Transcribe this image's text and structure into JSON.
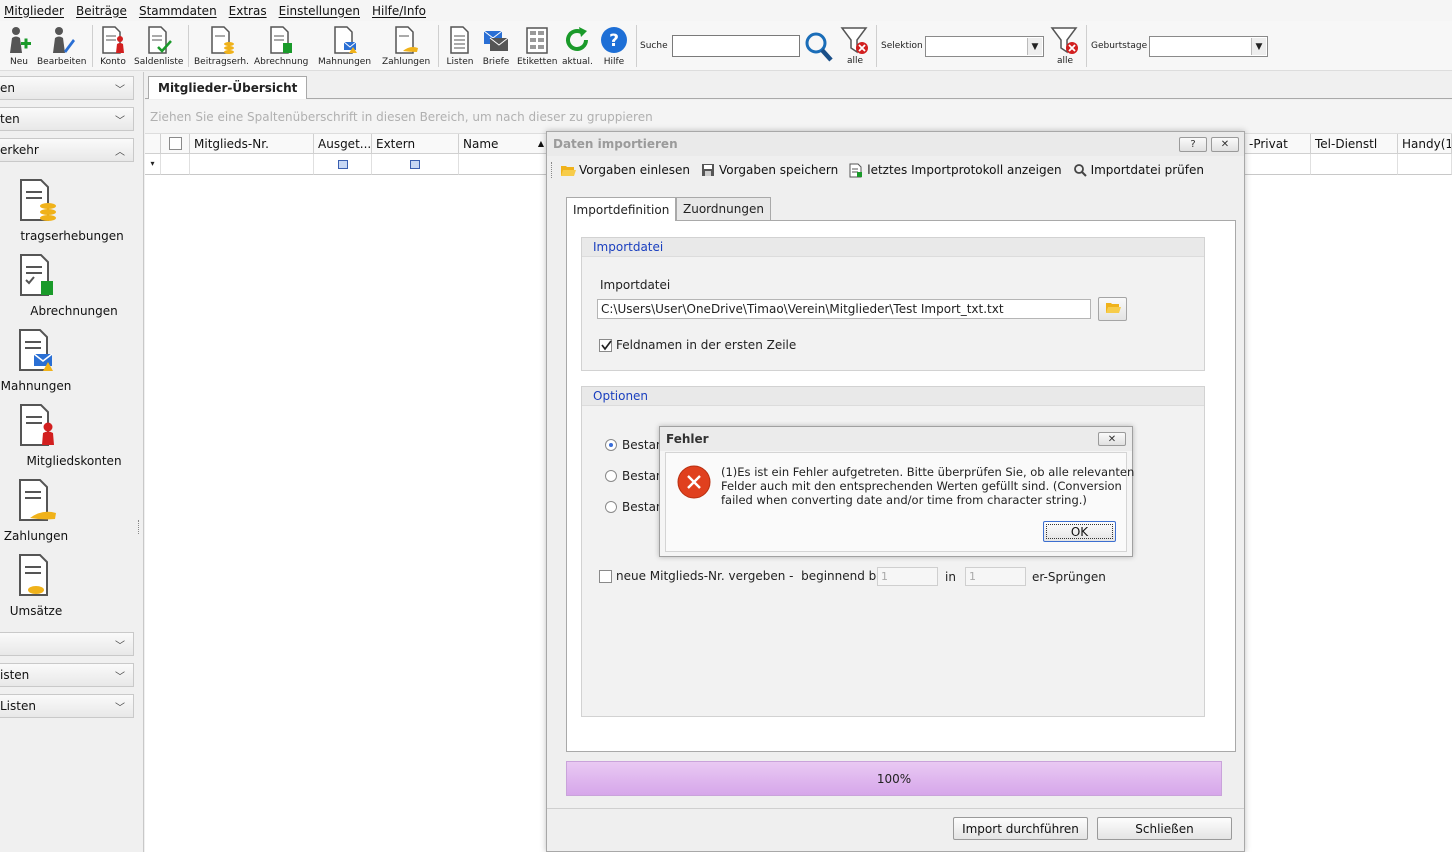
{
  "menu": [
    "Mitglieder",
    "Beiträge",
    "Stammdaten",
    "Extras",
    "Einstellungen",
    "Hilfe/Info"
  ],
  "toolbar": {
    "buttons": [
      {
        "label": "Neu"
      },
      {
        "label": "Bearbeiten"
      },
      {
        "label": "Konto"
      },
      {
        "label": "Saldenliste"
      },
      {
        "label": "Beitragserh."
      },
      {
        "label": "Abrechnung"
      },
      {
        "label": "Mahnungen"
      },
      {
        "label": "Zahlungen"
      },
      {
        "label": "Listen"
      },
      {
        "label": "Briefe"
      },
      {
        "label": "Etiketten"
      },
      {
        "label": "aktual."
      },
      {
        "label": "Hilfe"
      }
    ],
    "search_label": "Suche",
    "search_value": "",
    "filter_all_1": "alle",
    "selektion_label": "Selektion",
    "selektion_value": "",
    "filter_all_2": "alle",
    "geburtstage_label": "Geburtstage",
    "geburtstage_value": ""
  },
  "sidebar": {
    "headers": [
      "en",
      "ten",
      "erkehr"
    ],
    "items": [
      "tragserhebungen",
      "Abrechnungen",
      "Mahnungen",
      "Mitgliedskonten",
      "Zahlungen",
      "Umsätze"
    ],
    "headers_bottom": [
      "",
      "isten",
      "Listen"
    ]
  },
  "main": {
    "tab_title": "Mitglieder-Übersicht",
    "group_hint": "Ziehen Sie eine Spaltenüberschrift in diesen Bereich, um nach dieser zu gruppieren",
    "columns": [
      "Mitglieds-Nr.",
      "Ausget...",
      "Extern",
      "Name"
    ],
    "columns_right": [
      "-Privat",
      "Tel-Dienstl",
      "Handy(1)"
    ],
    "filter_icon": "▾"
  },
  "import_dialog": {
    "title": "Daten importieren",
    "help_btn": "?",
    "close_btn": "✕",
    "toolbar": [
      "Vorgaben einlesen",
      "Vorgaben speichern",
      "letztes Importprotokoll anzeigen",
      "Importdatei prüfen"
    ],
    "tabs": [
      "Importdefinition",
      "Zuordnungen"
    ],
    "group_file": {
      "header": "Importdatei",
      "label": "Importdatei",
      "path": "C:\\Users\\User\\OneDrive\\Timao\\Verein\\Mitglieder\\Test Import_txt.txt",
      "checkbox_label": "Feldnamen in der ersten Zeile",
      "checkbox_checked": true
    },
    "group_options": {
      "header": "Optionen",
      "radios": [
        "Bestan",
        "Bestan",
        "Bestan"
      ],
      "new_nr_label": "neue Mitglieds-Nr. vergeben -  beginnend bei",
      "start_value": "1",
      "in_label": "in",
      "step_value": "1",
      "steps_label": "er-Sprüngen"
    },
    "progress": "100%",
    "btn_import": "Import durchführen",
    "btn_close": "Schließen"
  },
  "error_dialog": {
    "title": "Fehler",
    "close": "✕",
    "message_l1": "(1)Es ist ein Fehler aufgetreten. Bitte überprüfen Sie, ob alle relevanten",
    "message_l2": "Felder auch mit den entsprechenden Werten gefüllt sind. (Conversion",
    "message_l3": "failed when converting date and/or time from character string.)",
    "ok": "OK"
  },
  "colors": {
    "accent_blue": "#1a3fbf",
    "error_red": "#e0401e",
    "progress": "#d6a6ea",
    "green": "#1a9a2a"
  }
}
